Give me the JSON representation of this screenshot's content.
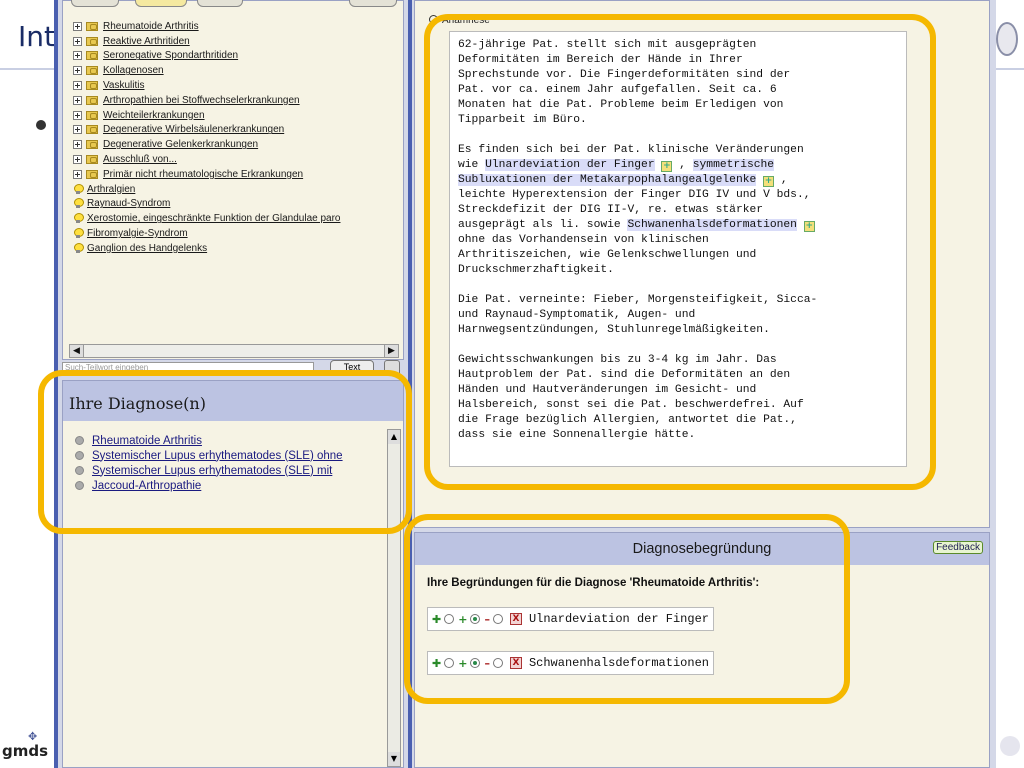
{
  "slide": {
    "title_fragment": "Int",
    "footer_logo": "gmds"
  },
  "tree": {
    "items": [
      {
        "label": "Rheumatoide Arthritis",
        "kind": "folder"
      },
      {
        "label": "Reaktive Arthritiden",
        "kind": "folder"
      },
      {
        "label": "Seronegative Spondarthritiden",
        "kind": "folder"
      },
      {
        "label": "Kollagenosen",
        "kind": "folder"
      },
      {
        "label": "Vaskulitis",
        "kind": "folder"
      },
      {
        "label": "Arthropathien bei Stoffwechselerkrankungen",
        "kind": "folder"
      },
      {
        "label": "Weichteilerkrankungen",
        "kind": "folder"
      },
      {
        "label": "Degenerative Wirbelsäulenerkrankungen",
        "kind": "folder"
      },
      {
        "label": "Degenerative Gelenkerkrankungen",
        "kind": "folder"
      },
      {
        "label": "Ausschluß von...",
        "kind": "folder"
      },
      {
        "label": "Primär nicht rheumatologische Erkrankungen",
        "kind": "folder"
      },
      {
        "label": "Arthralgien",
        "kind": "leaf"
      },
      {
        "label": "Raynaud-Syndrom",
        "kind": "leaf"
      },
      {
        "label": "Xerostomie, eingeschränkte Funktion der Glandulae paro",
        "kind": "leaf"
      },
      {
        "label": "Fibromyalgie-Syndrom",
        "kind": "leaf"
      },
      {
        "label": "Ganglion des Handgelenks",
        "kind": "leaf"
      }
    ]
  },
  "search": {
    "placeholder": "Such-Teilwort eingeben",
    "button_label": "Text"
  },
  "diagnoses": {
    "title": "Ihre Diagnose(n)",
    "items": [
      "Rheumatoide Arthritis",
      "Systemischer Lupus erhythematodes (SLE) ohne",
      "Systemischer Lupus erhythematodes (SLE) mit",
      "Jaccoud-Arthropathie"
    ]
  },
  "anamnese": {
    "label": "Anamnese",
    "p1": "62-jährige Pat. stellt sich mit ausgeprägten\nDeformitäten im Bereich der Hände in Ihrer\nSprechstunde vor. Die Fingerdeformitäten sind der\nPat. vor ca. einem Jahr aufgefallen. Seit ca. 6\nMonaten hat die Pat. Probleme beim Erledigen von\nTipparbeit im Büro.",
    "p2_intro": "Es finden sich bei der Pat. klinische Veränderungen\nwie ",
    "hl1": "Ulnardeviation der Finger",
    "sep1": " , ",
    "hl2a": "symmetrische",
    "hl2b": "Subluxationen der Metakarpophalangealgelenke",
    "sep2": " ,\nleichte Hyperextension der Finger DIG IV und V bds.,\nStreckdefizit der DIG II-V, re. etwas stärker\nausgeprägt als li. sowie ",
    "hl3": "Schwanenhalsdeformationen",
    "p2_end": "\nohne das Vorhandensein von klinischen\nArthritiszeichen, wie Gelenkschwellungen und\nDruckschmerzhaftigkeit.",
    "p3": "Die Pat. verneinte: Fieber, Morgensteifigkeit, Sicca-\nund Raynaud-Symptomatik, Augen- und\nHarnwegsentzündungen, Stuhlunregelmäßigkeiten.",
    "p4": "Gewichtsschwankungen bis zu 3-4 kg im Jahr. Das\nHautproblem der Pat. sind die Deformitäten an den\nHänden und Hautveränderungen im Gesicht- und\nHalsbereich, sonst sei die Pat. beschwerdefrei. Auf\ndie Frage bezüglich Allergien, antwortet die Pat.,\ndass sie eine Sonnenallergie hätte."
  },
  "begruendung": {
    "title": "Diagnosebegründung",
    "feedback_label": "Feedback",
    "intro": "Ihre Begründungen für die Diagnose 'Rheumatoide Arthritis':",
    "reasons": [
      {
        "label": "Ulnardeviation der Finger",
        "selected": "plus"
      },
      {
        "label": "Schwanenhalsdeformationen",
        "selected": "plus"
      }
    ]
  },
  "colors": {
    "highlight_ring": "#f5b800",
    "panel_header": "#bcc3e2",
    "window_frame": "#4a5fb0"
  }
}
